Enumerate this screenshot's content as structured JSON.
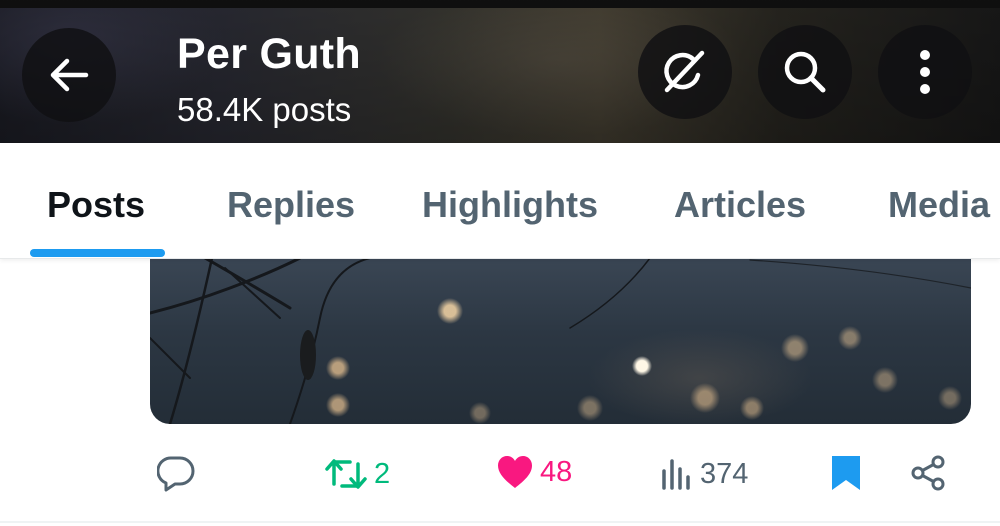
{
  "header": {
    "profile_name": "Per Guth",
    "post_count": "58.4K posts",
    "buttons": {
      "back_icon": "arrow-left-icon",
      "grok_icon": "grok-icon",
      "search_icon": "search-icon",
      "more_icon": "more-vertical-icon"
    }
  },
  "tabs": [
    {
      "label": "Posts",
      "active": true
    },
    {
      "label": "Replies",
      "active": false
    },
    {
      "label": "Highlights",
      "active": false
    },
    {
      "label": "Articles",
      "active": false
    },
    {
      "label": "Media",
      "active": false
    }
  ],
  "post": {
    "actions": {
      "reply": {
        "icon": "reply-icon",
        "count": ""
      },
      "repost": {
        "icon": "repost-icon",
        "count": "2"
      },
      "like": {
        "icon": "heart-icon",
        "count": "48",
        "liked": true
      },
      "views": {
        "icon": "views-icon",
        "count": "374"
      },
      "bookmark": {
        "icon": "bookmark-icon",
        "bookmarked": true
      },
      "share": {
        "icon": "share-icon"
      }
    }
  },
  "colors": {
    "accent": "#1d9bf0",
    "repost_green": "#00ba7c",
    "like_pink": "#f91880",
    "muted_text": "#536471",
    "primary_text": "#0f1419"
  }
}
